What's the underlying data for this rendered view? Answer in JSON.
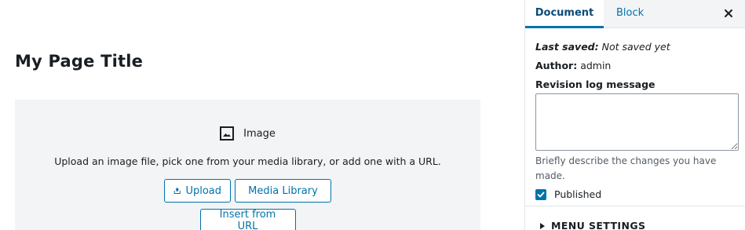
{
  "editor": {
    "page_title": "My Page Title",
    "image_block": {
      "title": "Image",
      "icon": "image-icon",
      "instructions": "Upload an image file, pick one from your media library, or add one with a URL.",
      "upload_label": "Upload",
      "media_library_label": "Media Library",
      "insert_url_label": "Insert from URL"
    }
  },
  "sidebar": {
    "tabs": [
      {
        "label": "Document",
        "active": true
      },
      {
        "label": "Block",
        "active": false
      }
    ],
    "close_icon": "close-icon",
    "last_saved_label": "Last saved:",
    "last_saved_value": "Not saved yet",
    "author_label": "Author:",
    "author_value": "admin",
    "revision_label": "Revision log message",
    "revision_value": "",
    "revision_help": "Briefly describe the changes you have made.",
    "published_label": "Published",
    "published_checked": true,
    "menu_settings_label": "MENU SETTINGS"
  },
  "colors": {
    "accent": "#0073aa",
    "placeholder_bg": "#f3f4f5",
    "text": "#191e23"
  }
}
